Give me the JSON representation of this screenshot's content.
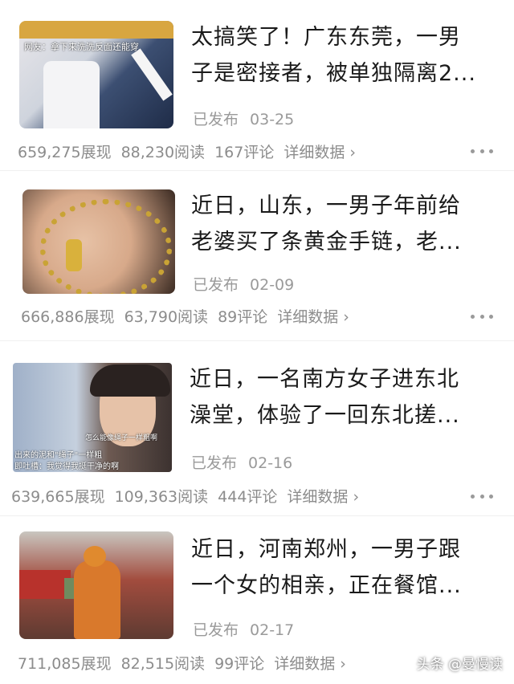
{
  "articles": [
    {
      "title_line1": "太搞笑了！广东东莞，一男",
      "title_line2": "子是密接者，被单独隔离2...",
      "published_label": "已发布",
      "date": "03-25",
      "views": "659,275展现",
      "reads": "88,230阅读",
      "comments": "167评论",
      "detail_label": "详细数据 ›",
      "thumb_caption": "网友：拿下来洗洗反面还能穿"
    },
    {
      "title_line1": "近日，山东，一男子年前给",
      "title_line2": "老婆买了条黄金手链，老...",
      "published_label": "已发布",
      "date": "02-09",
      "views": "666,886展现",
      "reads": "63,790阅读",
      "comments": "89评论",
      "detail_label": "详细数据 ›"
    },
    {
      "title_line1": "近日，一名南方女子进东北",
      "title_line2": "澡堂，体验了一回东北搓...",
      "published_label": "已发布",
      "date": "02-16",
      "views": "639,665展现",
      "reads": "109,363阅读",
      "comments": "444评论",
      "detail_label": "详细数据 ›",
      "thumb_caption_1": "怎么能像绳子一样粗啊",
      "thumb_caption_2": "出来的泥和\"绳子\"一样粗",
      "thumb_caption_3": "即吐槽：我觉得我挺干净的啊"
    },
    {
      "title_line1": "近日，河南郑州，一男子跟",
      "title_line2": "一个女的相亲，正在餐馆...",
      "published_label": "已发布",
      "date": "02-17",
      "views": "711,085展现",
      "reads": "82,515阅读",
      "comments": "99评论",
      "detail_label": "详细数据 ›"
    }
  ],
  "watermark": "头条 @曼慢读",
  "colors": {
    "text": "#1a1a1a",
    "muted": "#9a9a9a"
  }
}
